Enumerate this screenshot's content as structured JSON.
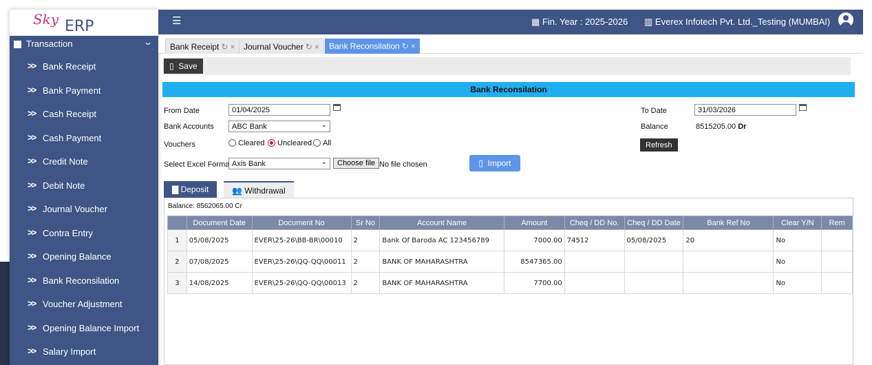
{
  "app": {
    "logo_script": "Sky",
    "logo_text": "ERP"
  },
  "sidebar": {
    "section": "Transaction",
    "items": [
      {
        "label": "Bank Receipt"
      },
      {
        "label": "Bank Payment"
      },
      {
        "label": "Cash Receipt"
      },
      {
        "label": "Cash Payment"
      },
      {
        "label": "Credit Note"
      },
      {
        "label": "Debit Note"
      },
      {
        "label": "Journal Voucher"
      },
      {
        "label": "Contra Entry"
      },
      {
        "label": "Opening Balance"
      },
      {
        "label": "Bank Reconsilation"
      },
      {
        "label": "Voucher Adjustment"
      },
      {
        "label": "Opening Balance Import"
      },
      {
        "label": "Salary Import"
      }
    ]
  },
  "header": {
    "fin_year": "Fin. Year : 2025-2026",
    "company": "Everex Infotech Pvt. Ltd._Testing (MUMBAI)"
  },
  "tabs": [
    {
      "label": "Bank Receipt"
    },
    {
      "label": "Journal Voucher"
    },
    {
      "label": "Bank Reconsilation"
    }
  ],
  "toolbar": {
    "save_label": "Save"
  },
  "panel": {
    "title": "Bank Reconsilation",
    "from_date_label": "From Date",
    "from_date_value": "01/04/2025",
    "to_date_label": "To Date",
    "to_date_value": "31/03/2026",
    "bank_accounts_label": "Bank Accounts",
    "bank_accounts_value": "ABC Bank",
    "balance_label": "Balance",
    "balance_value": "8515205.00",
    "balance_suffix": "Dr",
    "vouchers_label": "Vouchers",
    "voucher_options": [
      "Cleared",
      "Uncleared",
      "All"
    ],
    "voucher_selected": "Uncleared",
    "refresh_label": "Refresh",
    "excel_format_label": "Select Excel Format",
    "excel_format_value": "Axis Bank",
    "choose_file_label": "Choose file",
    "no_file_label": "No file chosen",
    "import_label": "Import"
  },
  "subtabs": {
    "deposit": "Deposit",
    "withdrawal": "Withdrawal"
  },
  "grid": {
    "balance": "Balance: 8562065.00 Cr",
    "columns": [
      "",
      "Document Date",
      "Document No",
      "Sr No",
      "Account Name",
      "Amount",
      "Cheq / DD No.",
      "Cheq / DD Date",
      "Bank Ref No",
      "Clear Y/N",
      "Rem"
    ],
    "rows": [
      {
        "idx": "1",
        "doc_date": "05/08/2025",
        "doc_no": "EVER\\25-26\\BB-BR\\00010",
        "sr_no": "2",
        "account": "Bank Of Baroda  AC 123456789",
        "amount": "7000.00",
        "cheq_no": "74512",
        "cheq_date": "05/08/2025",
        "bank_ref": "20",
        "clear": "No",
        "rem": ""
      },
      {
        "idx": "2",
        "doc_date": "07/08/2025",
        "doc_no": "EVER\\25-26\\QQ-QQ\\00011",
        "sr_no": "2",
        "account": "BANK OF MAHARASHTRA",
        "amount": "8547365.00",
        "cheq_no": "",
        "cheq_date": "",
        "bank_ref": "",
        "clear": "No",
        "rem": ""
      },
      {
        "idx": "3",
        "doc_date": "14/08/2025",
        "doc_no": "EVER\\25-26\\QQ-QQ\\00013",
        "sr_no": "2",
        "account": "BANK OF MAHARASHTRA",
        "amount": "7700.00",
        "cheq_no": "",
        "cheq_date": "",
        "bank_ref": "",
        "clear": "No",
        "rem": ""
      }
    ]
  },
  "colors": {
    "sidebar": "#3e5585",
    "panel_title": "#21aeef",
    "active_tab": "#5d95e8",
    "grid_header": "#7c8aa8"
  }
}
